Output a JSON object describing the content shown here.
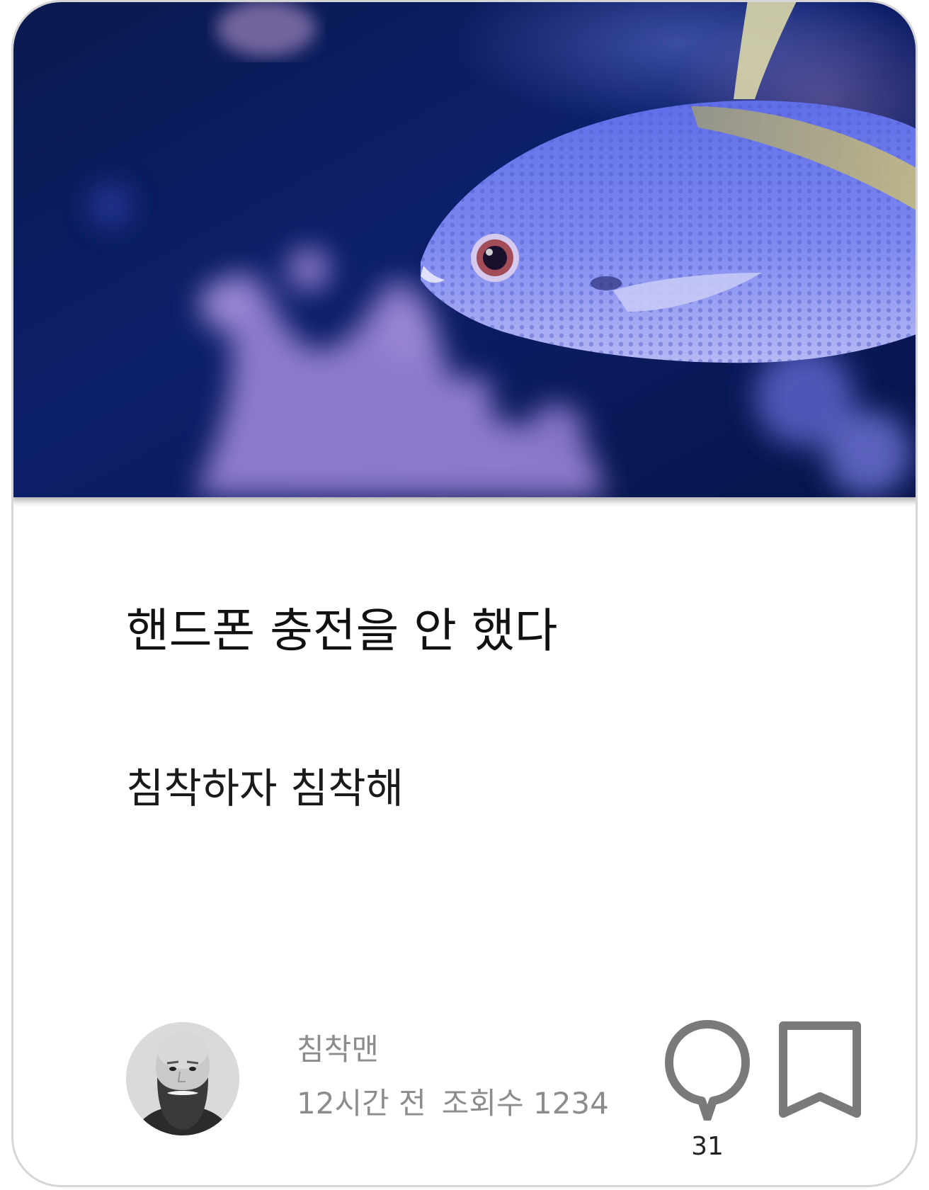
{
  "post": {
    "title": "핸드폰 충전을 안 했다",
    "body": "침착하자 침착해",
    "hero_image": "fish-photo"
  },
  "author": {
    "name": "침착맨",
    "avatar": "bearded-man-photo",
    "time_ago": "12시간 전",
    "views_label": "조회수 1234"
  },
  "actions": {
    "comment_icon": "speech-bubble-icon",
    "comment_count": "31",
    "bookmark_icon": "bookmark-icon"
  },
  "colors": {
    "icon_gray": "#7a7a7a",
    "meta_gray": "#8c8c8c",
    "card_border": "#d6d6d6"
  }
}
